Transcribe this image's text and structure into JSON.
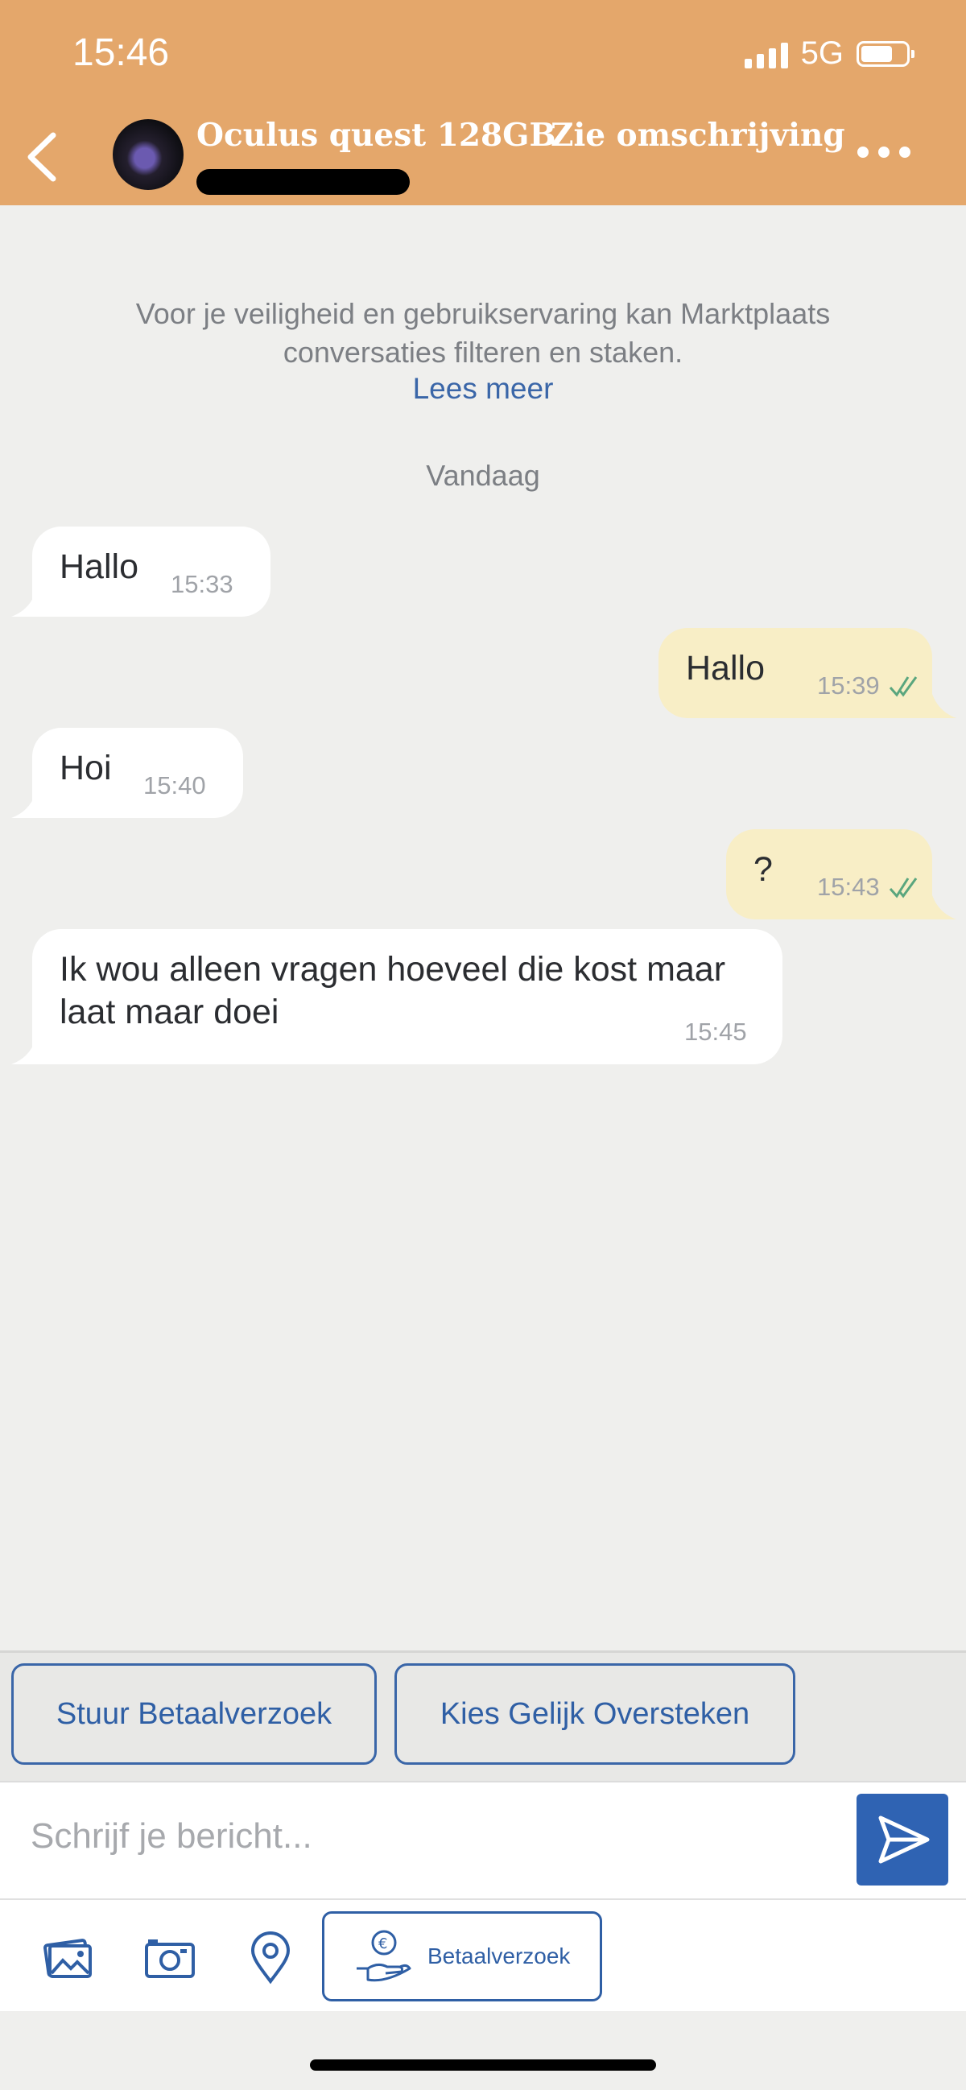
{
  "status_bar": {
    "time": "15:46",
    "network": "5G"
  },
  "header": {
    "title": "Oculus quest 128GB",
    "description_link": "Zie omschrijving"
  },
  "notice": {
    "text": "Voor je veiligheid en gebruikservaring kan Marktplaats conversaties filteren en staken.",
    "link": "Lees meer"
  },
  "day_label": "Vandaag",
  "messages": [
    {
      "direction": "in",
      "text": "Hallo",
      "time": "15:33"
    },
    {
      "direction": "out",
      "text": "Hallo",
      "time": "15:39",
      "read": true
    },
    {
      "direction": "in",
      "text": "Hoi",
      "time": "15:40"
    },
    {
      "direction": "out",
      "text": "?",
      "time": "15:43",
      "read": true
    },
    {
      "direction": "in",
      "text": "Ik wou alleen vragen hoeveel die kost maar laat maar doei",
      "time": "15:45"
    }
  ],
  "quick_replies": [
    "Stuur Betaalverzoek",
    "Kies Gelijk Oversteken"
  ],
  "composer": {
    "placeholder": "Schrijf je bericht..."
  },
  "toolbar": {
    "pay_label": "Betaalverzoek",
    "icons": [
      "gallery-icon",
      "camera-icon",
      "location-icon",
      "payment-request-icon"
    ]
  },
  "colors": {
    "header": "#e4a76b",
    "accent": "#2f63b3",
    "outgoing_bubble": "#f8eec6",
    "background": "#efefed"
  }
}
